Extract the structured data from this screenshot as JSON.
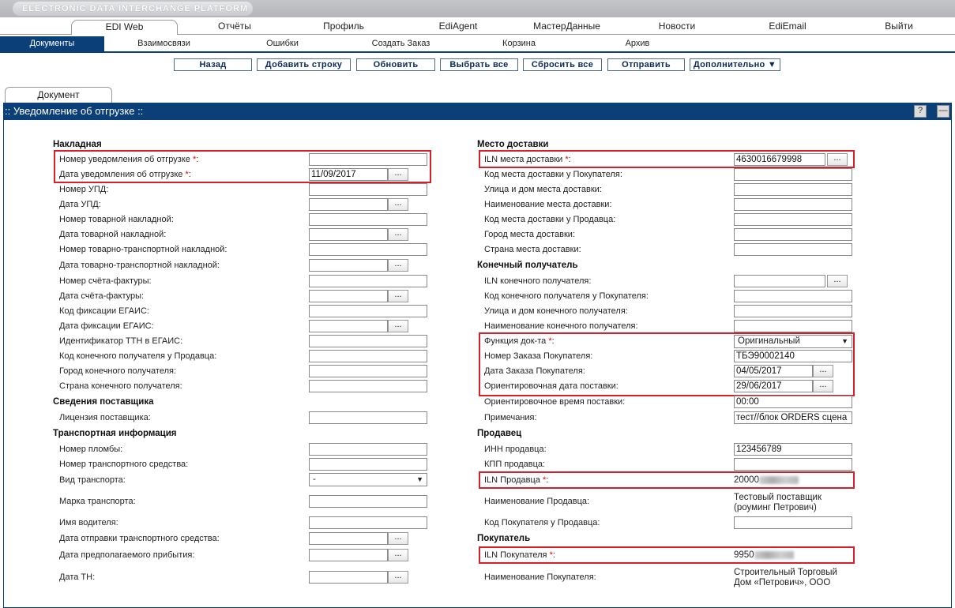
{
  "platform_title": "ELECTRONIC DATA INTERCHANGE PLATFORM",
  "main_nav": {
    "active": "EDI Web",
    "items": [
      "Отчёты",
      "Профиль",
      "EdiAgent",
      "МастерДанные",
      "Новости",
      "EdiEmail",
      "Выйти"
    ]
  },
  "sub_nav": {
    "active": "Документы",
    "items": [
      "Взаимосвязи",
      "Ошибки",
      "Создать Заказ",
      "Корзина",
      "Архив"
    ]
  },
  "toolbar": {
    "back": "Назад",
    "add_row": "Добавить строку",
    "refresh": "Обновить",
    "select_all": "Выбрать все",
    "reset_all": "Сбросить все",
    "send": "Отправить",
    "more": "Дополнительно ▼"
  },
  "doc_tab": "Документ",
  "panel_title": ":: Уведомление об отгрузке ::",
  "header_buttons": {
    "help": "?",
    "minimize": "—"
  },
  "dots": "...",
  "req_mark": "*",
  "left": {
    "nakladnaya": "Накладная",
    "f1": "Номер уведомления об отгрузке",
    "f2": "Дата уведомления об отгрузке",
    "f2_value": "11/09/2017",
    "f3": "Номер УПД:",
    "f4": "Дата УПД:",
    "f5": "Номер товарной накладной:",
    "f6": "Дата товарной накладной:",
    "f7": "Номер товарно-транспортной накладной:",
    "f8": "Дата товарно-транспортной накладной:",
    "f9": "Номер счёта-фактуры:",
    "f10": "Дата счёта-фактуры:",
    "f11": "Код фиксации ЕГАИС:",
    "f12": "Дата фиксации ЕГАИС:",
    "f13": "Идентификатор ТТН в ЕГАИС:",
    "f14": "Код конечного получателя у Продавца:",
    "f15": "Город конечного получателя:",
    "f16": "Страна конечного получателя:",
    "supplier_section": "Сведения поставщика",
    "f17": "Лицензия поставщика:",
    "transport_section": "Транспортная информация",
    "f18": "Номер пломбы:",
    "f19": "Номер транспортного средства:",
    "f20": "Вид транспорта:",
    "f20_value": "-",
    "f21": "Марка транспорта:",
    "f22": "Имя водителя:",
    "f23": "Дата отправки транспортного средства:",
    "f24": "Дата предполагаемого прибытия:",
    "f25": "Дата ТН:"
  },
  "right": {
    "delivery_section": "Место доставки",
    "r1": "ILN места доставки",
    "r1_value": "4630016679998",
    "r2": "Код места доставки у Покупателя:",
    "r3": "Улица и дом места доставки:",
    "r4": "Наименование места доставки:",
    "r5": "Код места доставки у Продавца:",
    "r6": "Город места доставки:",
    "r7": "Страна места доставки:",
    "final_section": "Конечный получатель",
    "r8": "ILN конечного получателя:",
    "r9": "Код конечного получателя у Покупателя:",
    "r10": "Улица и дом конечного получателя:",
    "r11": "Наименование конечного получателя:",
    "r12": "Функция док-та",
    "r12_value": "Оригинальный",
    "r13": "Номер Заказа Покупателя:",
    "r13_value": "ТБЭ90002140",
    "r14": "Дата Заказа Покупателя:",
    "r14_value": "04/05/2017",
    "r15": "Ориентировочная дата поставки:",
    "r15_value": "29/06/2017",
    "r16": "Ориентировочное время поставки:",
    "r16_value": "00:00",
    "r17": "Примечания:",
    "r17_value": "тест//блок ORDERS сцена",
    "seller_section": "Продавец",
    "r18": "ИНН продавца:",
    "r18_value": "123456789",
    "r19": "КПП продавца:",
    "r20": "ILN Продавца",
    "r20_value": "20000",
    "r21": "Наименование Продавца:",
    "r21_value_line1": "Тестовый поставщик",
    "r21_value_line2": "(роуминг Петрович)",
    "r22": "Код Покупателя у Продавца:",
    "buyer_section": "Покупатель",
    "r23": "ILN Покупателя",
    "r23_value": "9950",
    "r24": "Наименование Покупателя:",
    "r24_value_line1": "Строительный Торговый",
    "r24_value_line2": "Дом «Петрович», ООО"
  }
}
